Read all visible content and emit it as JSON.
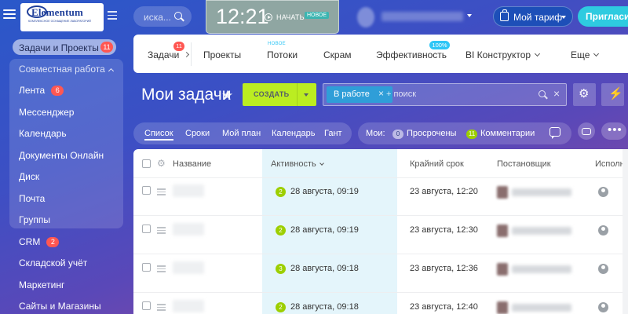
{
  "header": {
    "logo_text": "Elementum",
    "logo_subtitle": "КОМПЛЕКСНОЕ ОСНАЩЕНИЕ ЛАБОРАТОРИЙ",
    "search_placeholder": "иска...",
    "clock_time": "12:21",
    "start_label": "НАЧАТЬ",
    "start_badge": "НОВОЕ",
    "tariff_label": "Мой тариф",
    "invite_label": "Пригласить"
  },
  "sidebar": {
    "top_item": {
      "label": "Задачи и Проекты",
      "count": "11"
    },
    "group_label": "Совместная работа",
    "items": [
      {
        "label": "Лента",
        "count": "6"
      },
      {
        "label": "Мессенджер"
      },
      {
        "label": "Календарь"
      },
      {
        "label": "Документы Онлайн"
      },
      {
        "label": "Диск"
      },
      {
        "label": "Почта"
      },
      {
        "label": "Группы"
      }
    ],
    "extra_items": [
      {
        "label": "CRM",
        "count": "2"
      },
      {
        "label": "Складской учёт"
      },
      {
        "label": "Маркетинг"
      },
      {
        "label": "Сайты и Магазины"
      }
    ]
  },
  "tabs": {
    "items": [
      "Задачи",
      "Проекты",
      "Потоки",
      "Скрам",
      "Эффективность",
      "BI Конструктор",
      "Еще"
    ],
    "tasks_count": "11",
    "flows_new": "НОВОЕ",
    "efficiency_pct": "100%"
  },
  "toolbar": {
    "title": "Мои задачи",
    "create_label": "СОЗДАТЬ",
    "filter_chip": "В работе",
    "filter_chip_close": "×",
    "filter_placeholder": "+ поиск",
    "filter_clear": "×"
  },
  "views": {
    "items": [
      "Список",
      "Сроки",
      "Мой план",
      "Календарь",
      "Гант"
    ],
    "active": "Список"
  },
  "counters": {
    "label": "Мои:",
    "overdue": {
      "count": "0",
      "label": "Просрочены"
    },
    "comments": {
      "count": "11",
      "label": "Комментарии"
    }
  },
  "grid": {
    "headers": {
      "name": "Название",
      "activity": "Активность",
      "deadline": "Крайний срок",
      "creator": "Постановщик",
      "executor": "Исполнитель"
    },
    "rows": [
      {
        "activity_count": "2",
        "activity_date": "28 августа, 09:19",
        "deadline": "23 августа, 12:20"
      },
      {
        "activity_count": "2",
        "activity_date": "28 августа, 09:19",
        "deadline": "23 августа, 12:30"
      },
      {
        "activity_count": "3",
        "activity_date": "28 августа, 09:18",
        "deadline": "23 августа, 12:36"
      },
      {
        "activity_count": "2",
        "activity_date": "28 августа, 09:18",
        "deadline": "23 августа, 12:40"
      }
    ]
  },
  "colors": {
    "accent_green": "#bbed21",
    "counter_red": "#ff5752",
    "chip_blue": "#2f9ed8",
    "invite_cyan": "#2ecbe0"
  }
}
